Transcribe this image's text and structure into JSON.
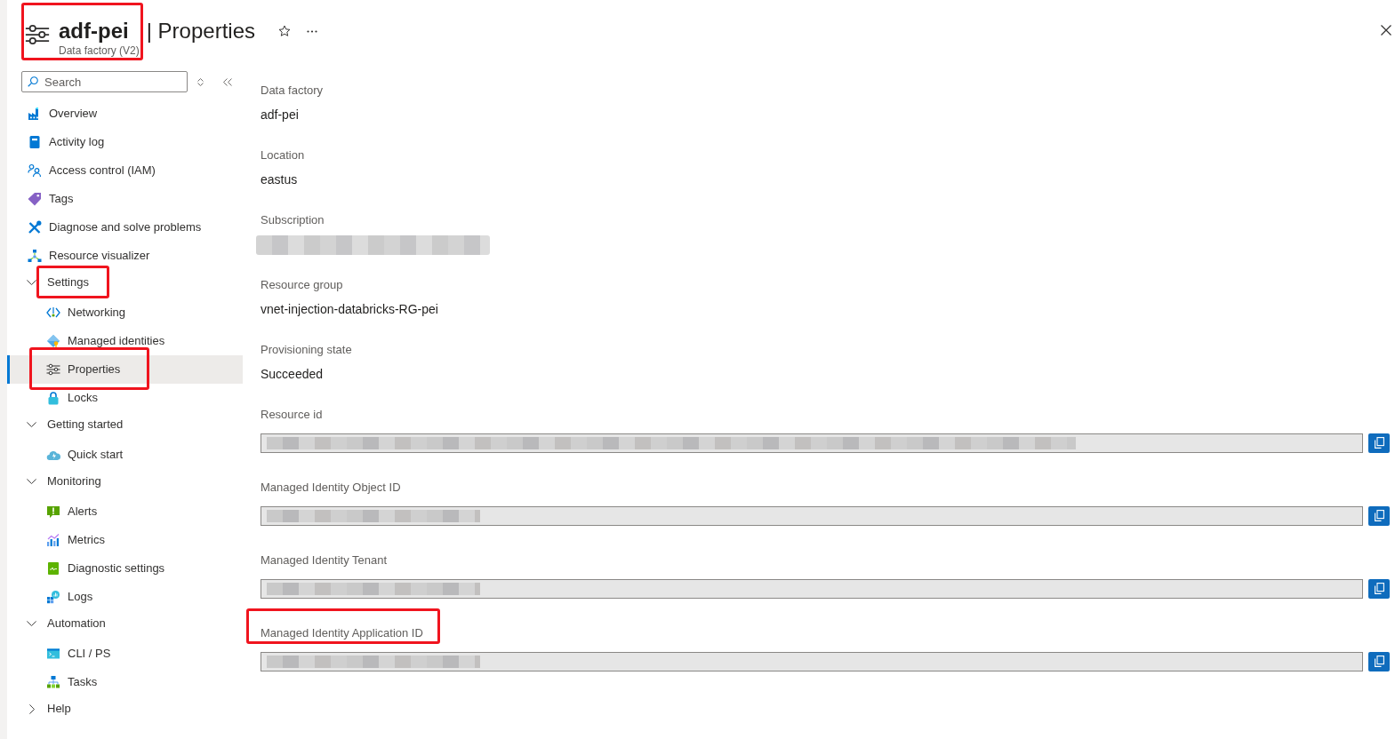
{
  "header": {
    "resource_name": "adf-pei",
    "section_title": "| Properties",
    "subtitle": "Data factory (V2)",
    "highlighted": true
  },
  "search": {
    "placeholder": "Search"
  },
  "sidebar": {
    "items": [
      {
        "label": "Overview",
        "selected": false,
        "highlighted": false
      },
      {
        "label": "Activity log",
        "selected": false,
        "highlighted": false
      },
      {
        "label": "Access control (IAM)",
        "selected": false,
        "highlighted": false
      },
      {
        "label": "Tags",
        "selected": false,
        "highlighted": false
      },
      {
        "label": "Diagnose and solve problems",
        "selected": false,
        "highlighted": false
      },
      {
        "label": "Resource visualizer",
        "selected": false,
        "highlighted": false
      },
      {
        "label": "Settings",
        "selected": false,
        "highlighted": true,
        "expanded": true,
        "children": [
          {
            "label": "Networking",
            "selected": false,
            "highlighted": false
          },
          {
            "label": "Managed identities",
            "selected": false,
            "highlighted": false
          },
          {
            "label": "Properties",
            "selected": true,
            "highlighted": true
          },
          {
            "label": "Locks",
            "selected": false,
            "highlighted": false
          }
        ]
      },
      {
        "label": "Getting started",
        "selected": false,
        "highlighted": false,
        "expanded": true,
        "children": [
          {
            "label": "Quick start",
            "selected": false,
            "highlighted": false
          }
        ]
      },
      {
        "label": "Monitoring",
        "selected": false,
        "highlighted": false,
        "expanded": true,
        "children": [
          {
            "label": "Alerts",
            "selected": false,
            "highlighted": false
          },
          {
            "label": "Metrics",
            "selected": false,
            "highlighted": false
          },
          {
            "label": "Diagnostic settings",
            "selected": false,
            "highlighted": false
          },
          {
            "label": "Logs",
            "selected": false,
            "highlighted": false
          }
        ]
      },
      {
        "label": "Automation",
        "selected": false,
        "highlighted": false,
        "expanded": true,
        "children": [
          {
            "label": "CLI / PS",
            "selected": false,
            "highlighted": false
          },
          {
            "label": "Tasks",
            "selected": false,
            "highlighted": false
          }
        ]
      },
      {
        "label": "Help",
        "selected": false,
        "highlighted": false,
        "expanded": false
      }
    ]
  },
  "fields": [
    {
      "kind": "text",
      "label": "Data factory",
      "value": "adf-pei",
      "highlighted": false
    },
    {
      "kind": "text",
      "label": "Location",
      "value": "eastus",
      "highlighted": false
    },
    {
      "kind": "redacted",
      "label": "Subscription",
      "highlighted": false
    },
    {
      "kind": "text",
      "label": "Resource group",
      "value": "vnet-injection-databricks-RG-pei",
      "highlighted": false
    },
    {
      "kind": "text",
      "label": "Provisioning state",
      "value": "Succeeded",
      "highlighted": false
    },
    {
      "kind": "pathbox",
      "label": "Resource id",
      "highlighted": false
    },
    {
      "kind": "guidbox",
      "label": "Managed Identity Object ID",
      "highlighted": false
    },
    {
      "kind": "guidbox",
      "label": "Managed Identity Tenant",
      "highlighted": false
    },
    {
      "kind": "guidbox",
      "label": "Managed Identity Application ID",
      "highlighted": true
    }
  ]
}
